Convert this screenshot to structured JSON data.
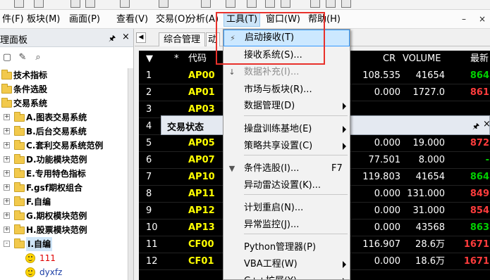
{
  "menubar": {
    "items": [
      "件(F)",
      "板块(M)",
      "画面(P)",
      "查看(V)",
      "交易(O)",
      "分析(A)",
      "工具(T)",
      "窗口(W)",
      "帮助(H)"
    ],
    "mdi_min": "–",
    "mdi_close": "×"
  },
  "left_panel": {
    "title": "理面板",
    "pin": "🖈",
    "close": "×",
    "tree": [
      {
        "label": "技术指标",
        "kind": "folder"
      },
      {
        "label": "条件选股",
        "kind": "folder"
      },
      {
        "label": "交易系统",
        "kind": "folder"
      },
      {
        "label": "A.图表交易系统",
        "kind": "folder"
      },
      {
        "label": "B.后台交易系统",
        "kind": "folder"
      },
      {
        "label": "C.套利交易系统范例",
        "kind": "folder"
      },
      {
        "label": "D.功能模块范例",
        "kind": "folder"
      },
      {
        "label": "E.专用特色指标",
        "kind": "folder"
      },
      {
        "label": "F.gsf期权组合",
        "kind": "folder"
      },
      {
        "label": "F.自编",
        "kind": "folder"
      },
      {
        "label": "G.期权模块范例",
        "kind": "folder"
      },
      {
        "label": "H.股票模块范例",
        "kind": "folder"
      },
      {
        "label": "I.自编",
        "kind": "folder-open"
      },
      {
        "label": "111",
        "kind": "smile"
      },
      {
        "label": "dyxfz",
        "kind": "smile"
      }
    ]
  },
  "tabs": {
    "prev": "◀",
    "items": [
      "综合管理",
      "动"
    ]
  },
  "grid": {
    "headers": {
      "sort": "▼",
      "star": "*",
      "code": "代码",
      "cr": "CR",
      "volume": "VOLUME",
      "last": "最新"
    },
    "rows": [
      {
        "n": "1",
        "code": "AP00",
        "cr": "108.535",
        "vol": "41654",
        "last": "864",
        "color": "green"
      },
      {
        "n": "2",
        "code": "AP01",
        "cr": "0.000",
        "vol": "1727.0",
        "last": "861",
        "color": "red"
      },
      {
        "n": "3",
        "code": "AP03",
        "cr": "",
        "vol": "",
        "last": "",
        "color": "red"
      },
      {
        "n": "4",
        "code": "",
        "cr": "",
        "vol": "",
        "last": "",
        "color": "red"
      },
      {
        "n": "5",
        "code": "AP05",
        "cr": "0.000",
        "vol": "19.000",
        "last": "872",
        "color": "red"
      },
      {
        "n": "6",
        "code": "AP07",
        "cr": "77.501",
        "vol": "8.000",
        "last": "-",
        "color": "green"
      },
      {
        "n": "7",
        "code": "AP10",
        "cr": "119.803",
        "vol": "41654",
        "last": "864",
        "color": "green"
      },
      {
        "n": "8",
        "code": "AP11",
        "cr": "0.000",
        "vol": "131.000",
        "last": "849",
        "color": "red"
      },
      {
        "n": "9",
        "code": "AP12",
        "cr": "0.000",
        "vol": "31.000",
        "last": "854",
        "color": "red"
      },
      {
        "n": "10",
        "code": "AP13",
        "cr": "0.000",
        "vol": "43568",
        "last": "863",
        "color": "green"
      },
      {
        "n": "11",
        "code": "CF00",
        "cr": "116.907",
        "vol": "28.6万",
        "last": "1671",
        "color": "red"
      },
      {
        "n": "12",
        "code": "CF01",
        "cr": "0.000",
        "vol": "18.6万",
        "last": "1671",
        "color": "red"
      }
    ]
  },
  "trade_status": {
    "title": "交易状态",
    "pin": "🖈",
    "close": "×"
  },
  "tools_menu": {
    "items": [
      {
        "label": "启动接收(T)",
        "state": "hover",
        "icon": "plug-icon"
      },
      {
        "label": "接收系统(S)...",
        "state": "normal"
      },
      {
        "label": "数据补充(I)...",
        "state": "disabled",
        "icon": "download-icon"
      },
      {
        "label": "市场与板块(R)...",
        "state": "normal"
      },
      {
        "label": "数据管理(D)",
        "state": "normal",
        "submenu": true
      },
      {
        "label": "操盘训练基地(E)",
        "state": "normal",
        "submenu": true
      },
      {
        "label": "策略共享设置(C)",
        "state": "normal",
        "submenu": true
      },
      {
        "label": "条件选股(I)...",
        "state": "normal",
        "shortcut": "F7",
        "icon": "filter-icon"
      },
      {
        "label": "异动雷达设置(K)...",
        "state": "normal"
      },
      {
        "label": "计划重启(N)...",
        "state": "normal"
      },
      {
        "label": "异常监控(J)...",
        "state": "normal"
      },
      {
        "label": "Python管理器(P)",
        "state": "normal"
      },
      {
        "label": "VBA工程(W)",
        "state": "normal",
        "submenu": true
      },
      {
        "label": "C++扩展(Y)",
        "state": "normal",
        "submenu": true
      }
    ]
  },
  "colors": {
    "highlight_box": "#e8312b",
    "menu_hover": "#cce8ff",
    "grid_background": "#000000",
    "code_yellow": "#ffff00",
    "price_red": "#ff3c3c",
    "price_green": "#00d000"
  }
}
